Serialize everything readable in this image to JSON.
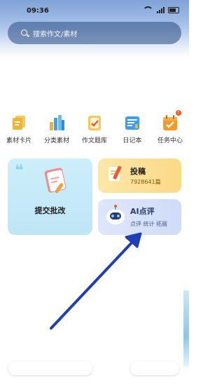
{
  "status_bar": {
    "time": "09:36"
  },
  "search": {
    "placeholder": "搜索作文/素材"
  },
  "quick_actions": [
    {
      "label": "素材卡片",
      "icon": "card-stack-icon",
      "color": "#f2b233"
    },
    {
      "label": "分类素材",
      "icon": "bar-books-icon",
      "color": "#3aa6e8"
    },
    {
      "label": "作文题库",
      "icon": "question-bank-icon",
      "color": "#f4a531"
    },
    {
      "label": "日记本",
      "icon": "diary-icon",
      "color": "#3d9df0"
    },
    {
      "label": "任务中心",
      "icon": "calendar-check-icon",
      "color": "#f39a2c",
      "badge": "!"
    }
  ],
  "cards": {
    "submit": {
      "label": "提交批改"
    },
    "tougao": {
      "label": "投稿",
      "count": "7928641篇"
    },
    "ai": {
      "label": "AI点评",
      "tags": "点评 统计 拓展"
    }
  },
  "annotation": {
    "arrow_color": "#1f3fb5"
  }
}
